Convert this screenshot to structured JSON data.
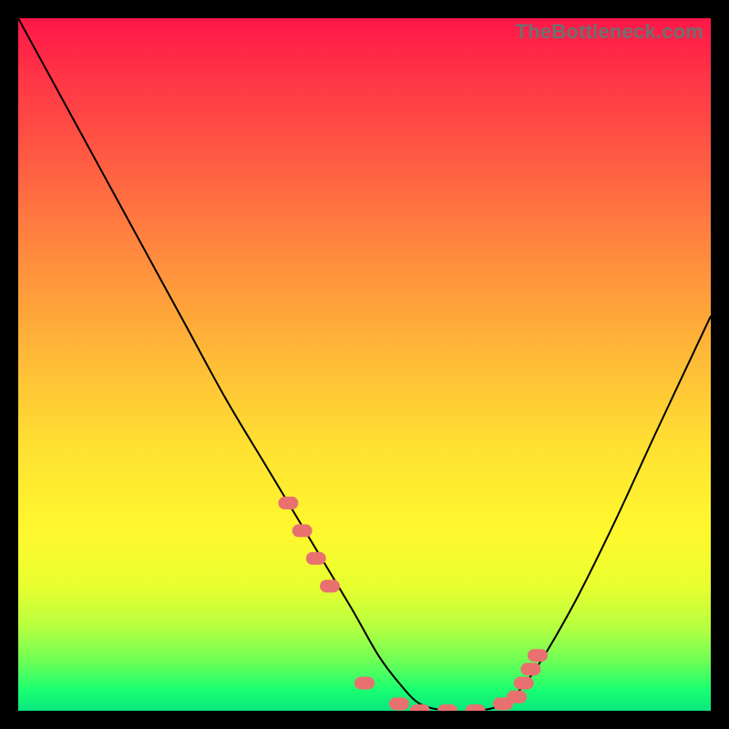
{
  "watermark": "TheBottleneck.com",
  "chart_data": {
    "type": "line",
    "title": "",
    "xlabel": "",
    "ylabel": "",
    "xlim": [
      0,
      100
    ],
    "ylim": [
      0,
      100
    ],
    "grid": false,
    "series": [
      {
        "name": "bottleneck-curve",
        "x": [
          0,
          6,
          12,
          18,
          24,
          30,
          36,
          42,
          48,
          52,
          55,
          58,
          62,
          66,
          70,
          74,
          80,
          86,
          92,
          100
        ],
        "values": [
          100,
          89,
          78,
          67,
          56,
          45,
          35,
          25,
          15,
          8,
          4,
          1,
          0,
          0,
          1,
          5,
          15,
          27,
          40,
          57
        ]
      }
    ],
    "markers": {
      "name": "highlight-dots",
      "color": "#e8716f",
      "x": [
        39,
        41,
        43,
        45,
        50,
        55,
        58,
        62,
        66,
        70,
        72,
        73,
        74,
        75
      ],
      "values": [
        30,
        26,
        22,
        18,
        4,
        1,
        0,
        0,
        0,
        1,
        2,
        4,
        6,
        8
      ]
    }
  }
}
